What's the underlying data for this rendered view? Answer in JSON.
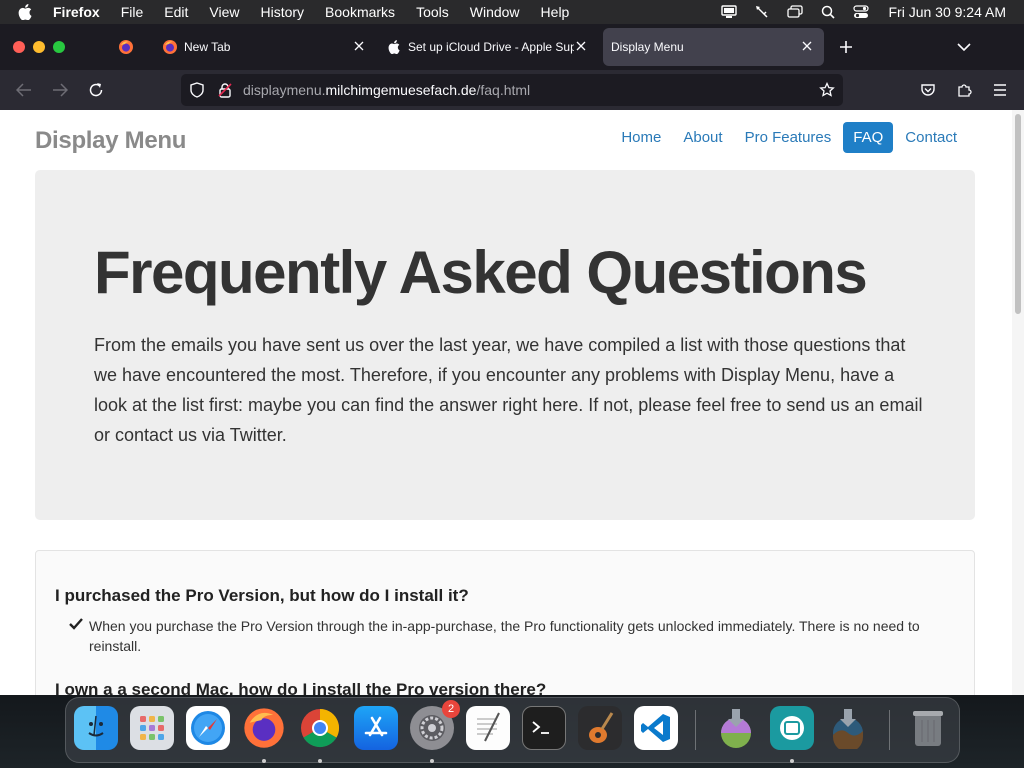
{
  "menubar": {
    "app_name": "Firefox",
    "menus": [
      "File",
      "Edit",
      "View",
      "History",
      "Bookmarks",
      "Tools",
      "Window",
      "Help"
    ],
    "clock": "Fri Jun 30  9:24 AM"
  },
  "tabs": [
    {
      "label": "New Tab",
      "icon": "firefox-icon"
    },
    {
      "label": "Set up iCloud Drive - Apple Sup",
      "icon": "apple-icon"
    },
    {
      "label": "Display Menu",
      "icon": ""
    }
  ],
  "urlbar": {
    "prefix": "displaymenu.",
    "host": "milchimgemuesefach.de",
    "path": "/faq.html"
  },
  "site": {
    "brand": "Display Menu",
    "nav": [
      "Home",
      "About",
      "Pro Features",
      "FAQ",
      "Contact"
    ],
    "active_nav": "FAQ",
    "hero_title": "Frequently Asked Questions",
    "hero_text": "From the emails you have sent us over the last year, we have compiled a list with those questions that we have encountered the most. Therefore, if you encounter any problems with Display Menu, have a look at the list first: maybe you can find the answer right here. If not, please feel free to send us an email or contact us via Twitter.",
    "faq": [
      {
        "question": "I purchased the Pro Version, but how do I install it?",
        "answer": "When you purchase the Pro Version through the in-app-purchase, the Pro functionality gets unlocked immediately. There is no need to reinstall."
      },
      {
        "question": "I own a a second Mac, how do I install the Pro version there?",
        "answer": ""
      }
    ]
  },
  "dock": {
    "apps": [
      "Finder",
      "Launchpad",
      "Safari",
      "Firefox",
      "Chrome",
      "App Store",
      "System Settings",
      "TextEdit",
      "Terminal",
      "GarageBand",
      "Visual Studio Code",
      "Sonoma Installer",
      "Mirroring",
      "Monterey Installer",
      "Trash"
    ],
    "settings_badge": "2"
  },
  "colors": {
    "link": "#2a7ab8",
    "active_nav_bg": "#1f7fc7",
    "hero_bg": "#eeeeee"
  }
}
